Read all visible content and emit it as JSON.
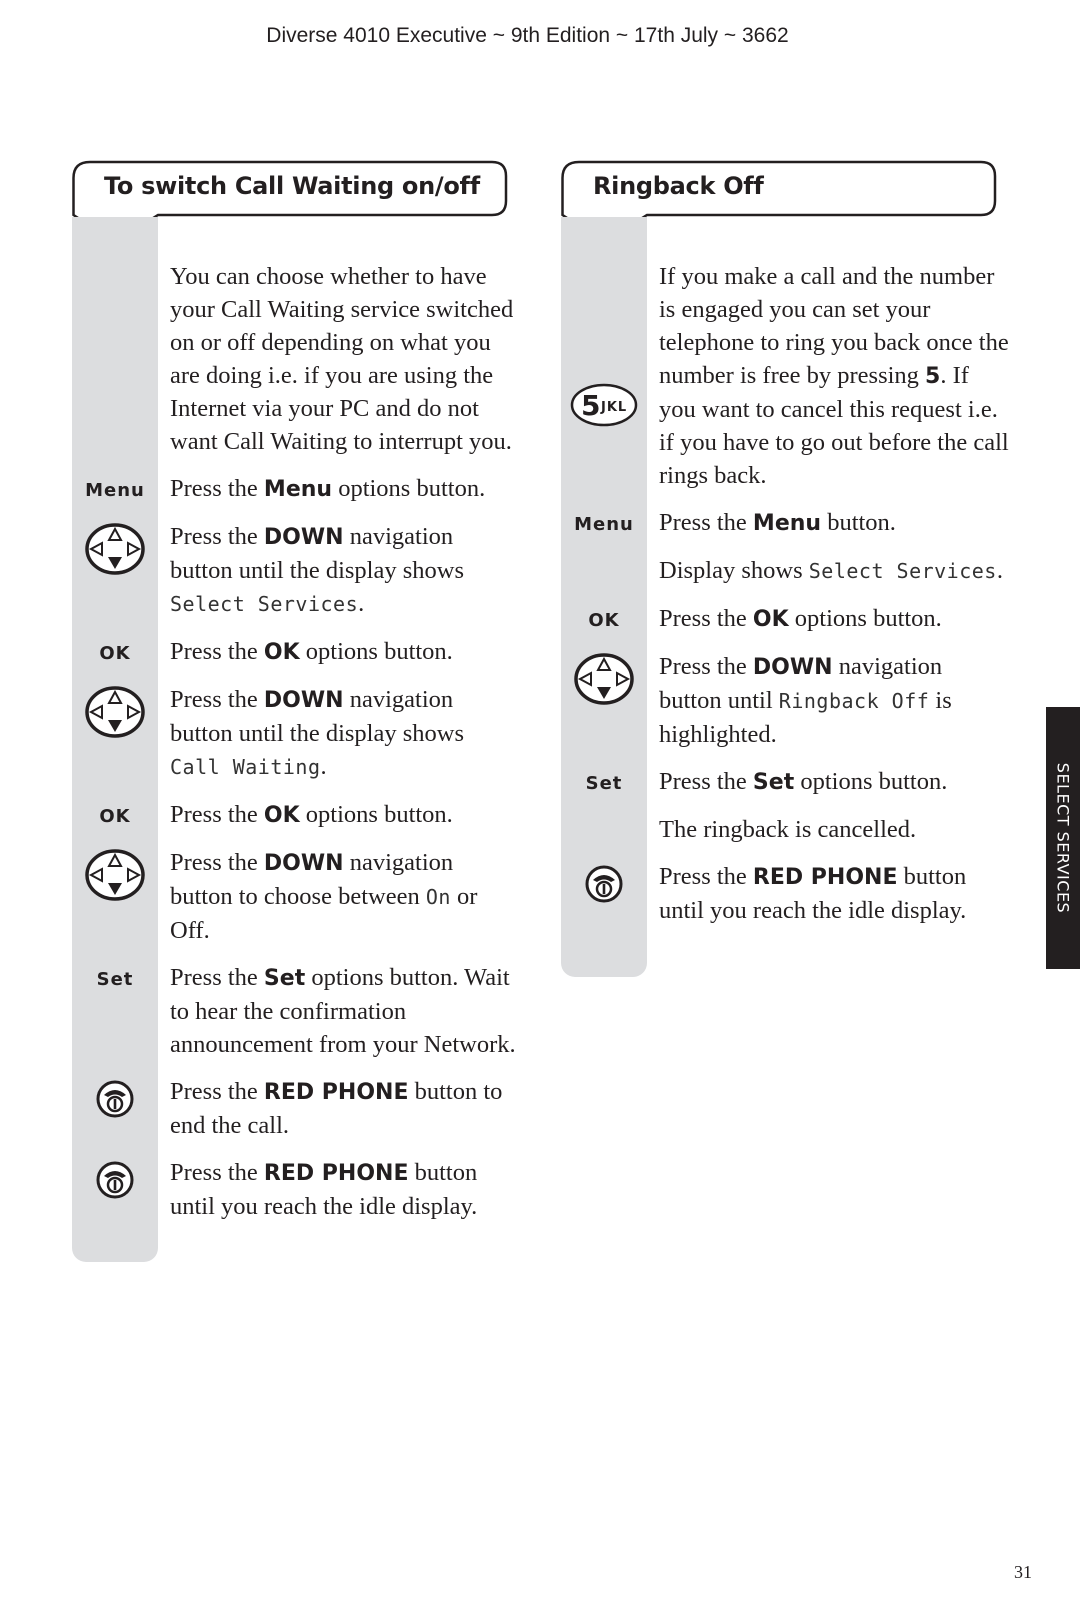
{
  "header": "Diverse 4010 Executive ~ 9th Edition ~ 17th July ~ 3662",
  "side_tab": "SELECT SERVICES",
  "page_number": "31",
  "left": {
    "title": "To switch Call Waiting on/off",
    "intro": "You can choose whether to have your Call Waiting service switched on or off depending on what you are doing i.e. if you are using the Internet via your PC and do not want Call Waiting to interrupt you.",
    "steps": [
      {
        "icon": "Menu",
        "pre": "Press the ",
        "bold": "Menu",
        "post": " options button.",
        "mono": "",
        "end": ""
      },
      {
        "icon": "nav",
        "pre": "Press the ",
        "bold": "DOWN",
        "post": " navigation button until the display shows ",
        "mono": "Select Services",
        "end": "."
      },
      {
        "icon": "OK",
        "pre": "Press the ",
        "bold": "OK",
        "post": " options button.",
        "mono": "",
        "end": ""
      },
      {
        "icon": "nav",
        "pre": "Press the ",
        "bold": "DOWN",
        "post": " navigation button until the display shows ",
        "mono": "Call Waiting",
        "end": "."
      },
      {
        "icon": "OK",
        "pre": "Press the ",
        "bold": "OK",
        "post": " options button.",
        "mono": "",
        "end": ""
      },
      {
        "icon": "nav",
        "pre": "Press the ",
        "bold": "DOWN",
        "post": " navigation button to choose between ",
        "mono": "On",
        "end": " or Off."
      },
      {
        "icon": "Set",
        "pre": "Press the ",
        "bold": "Set",
        "post": " options button. Wait to hear the confirmation announcement from your Network.",
        "mono": "",
        "end": ""
      },
      {
        "icon": "phone",
        "pre": "Press the ",
        "bold": "RED PHONE",
        "post": " button to end the call.",
        "mono": "",
        "end": ""
      },
      {
        "icon": "phone",
        "pre": "Press the ",
        "bold": "RED PHONE",
        "post": " button until you reach the idle display.",
        "mono": "",
        "end": ""
      }
    ]
  },
  "right": {
    "title": "Ringback Off",
    "steps": [
      {
        "icon": "5key",
        "pre": "If you make a call and the number is engaged you can set your telephone to ring you back once the number is free by pressing ",
        "bold": "5",
        "post": ". If you want to cancel this request i.e. if you have to go out before the call rings back.",
        "mono": "",
        "end": ""
      },
      {
        "icon": "Menu",
        "pre": "Press the ",
        "bold": "Menu",
        "post": " button.",
        "mono": "",
        "end": ""
      },
      {
        "icon": "",
        "pre": "Display shows ",
        "bold": "",
        "post": "",
        "mono": "Select Services",
        "end": "."
      },
      {
        "icon": "OK",
        "pre": "Press the ",
        "bold": "OK",
        "post": " options button.",
        "mono": "",
        "end": ""
      },
      {
        "icon": "nav",
        "pre": "Press the ",
        "bold": "DOWN",
        "post": " navigation button until ",
        "mono": "Ringback Off",
        "end": " is highlighted."
      },
      {
        "icon": "Set",
        "pre": "Press the ",
        "bold": "Set",
        "post": " options button.",
        "mono": "",
        "end": ""
      },
      {
        "icon": "",
        "pre": "The ringback is cancelled.",
        "bold": "",
        "post": "",
        "mono": "",
        "end": ""
      },
      {
        "icon": "phone",
        "pre": "Press the ",
        "bold": "RED PHONE",
        "post": " button until you reach the idle display.",
        "mono": "",
        "end": ""
      }
    ],
    "key5": {
      "digit": "5",
      "letters": "JKL"
    }
  }
}
